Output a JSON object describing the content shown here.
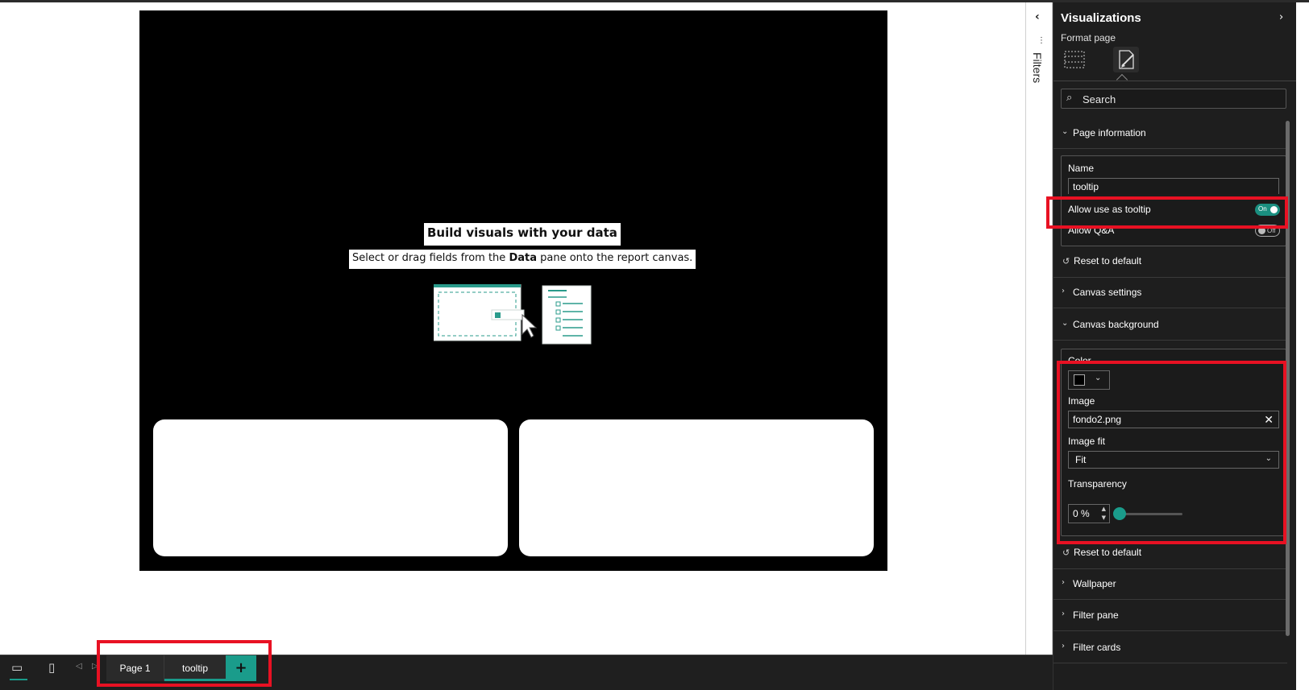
{
  "canvas": {
    "empty_state_title": "Build visuals with your data",
    "empty_state_sub_before": "Select or drag fields from the ",
    "empty_state_sub_bold": "Data",
    "empty_state_sub_after": " pane onto the report canvas."
  },
  "filters": {
    "label": "Filters",
    "collapse_icon": "chevron-left-icon"
  },
  "visualizations": {
    "title": "Visualizations",
    "expand_icon": "chevron-right-icon",
    "format_label": "Format page",
    "tabs": [
      {
        "icon": "visual-format-icon"
      },
      {
        "icon": "page-format-icon",
        "active": true
      }
    ],
    "search": {
      "placeholder": "Search"
    }
  },
  "page_information": {
    "header": "Page information",
    "name_label": "Name",
    "name_value": "tooltip",
    "tooltip_label": "Allow use as tooltip",
    "tooltip_toggle": "On",
    "qa_label": "Allow Q&A",
    "qa_toggle": "Off",
    "reset": "Reset to default"
  },
  "canvas_settings": {
    "header": "Canvas settings"
  },
  "canvas_background": {
    "header": "Canvas background",
    "color_label": "Color",
    "color_value": "#000000",
    "image_label": "Image",
    "image_value": "fondo2.png",
    "image_fit_label": "Image fit",
    "image_fit_value": "Fit",
    "transparency_label": "Transparency",
    "transparency_value": "0 %",
    "transparency_level": 0,
    "reset": "Reset to default"
  },
  "more_sections": {
    "wallpaper": "Wallpaper",
    "filter_pane": "Filter pane",
    "filter_cards": "Filter cards"
  },
  "bottom_bar": {
    "pages": [
      "Page 1",
      "tooltip"
    ],
    "active_page": "tooltip",
    "add_page": "+"
  },
  "colors": {
    "accent": "#1a9c8b",
    "highlight": "#e81123",
    "pane_bg": "#1e1e1e"
  }
}
